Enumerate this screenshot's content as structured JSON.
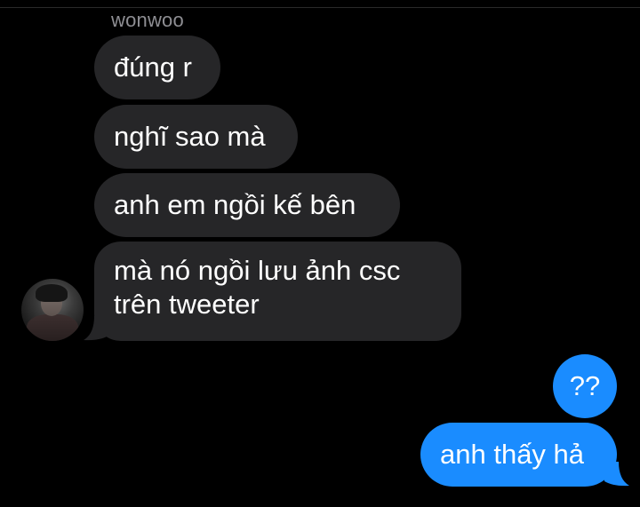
{
  "conversation": {
    "sender_name": "wonwoo",
    "incoming_messages": [
      {
        "text": "đúng r"
      },
      {
        "text": "nghĩ sao mà"
      },
      {
        "text": "anh em ngồi kế bên"
      },
      {
        "text": "mà nó ngồi lưu ảnh csc trên tweeter"
      }
    ],
    "outgoing_messages": [
      {
        "text": "??"
      },
      {
        "text": "anh thấy hả"
      }
    ]
  },
  "colors": {
    "background": "#000000",
    "incoming_bubble": "#262628",
    "outgoing_bubble": "#1a8cff",
    "sender_name": "#8e8e93",
    "text": "#ffffff"
  },
  "icons": {
    "avatar": "contact-avatar-photo"
  }
}
